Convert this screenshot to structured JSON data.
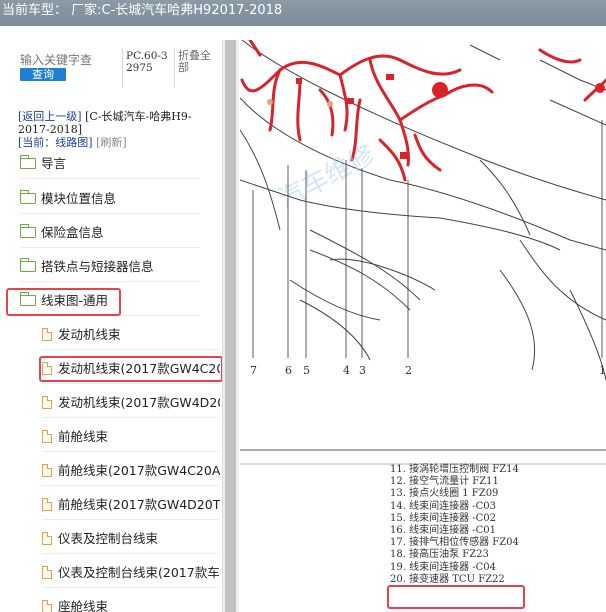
{
  "title": "当前车型：  厂家:C-长城汽车哈弗H92017-2018",
  "search": {
    "placeholder": "输入关键字查",
    "button": "查询"
  },
  "code": "PC.60-32975",
  "collapse_all": "折叠全部",
  "breadcrumb": {
    "back": "[返回上一级]",
    "current_model": "[C-长城汽车-哈弗H9-2017-2018]",
    "current_prefix": "[当前：",
    "current_page": "线路图",
    "current_suffix": "]",
    "refresh": "[刷新]"
  },
  "tree": [
    {
      "label": "导言",
      "icon": "folder-icon"
    },
    {
      "label": "模块位置信息",
      "icon": "folder-icon"
    },
    {
      "label": "保险盒信息",
      "icon": "folder-icon"
    },
    {
      "label": "搭铁点与短接器信息",
      "icon": "folder-icon"
    },
    {
      "label": "线束图-通用",
      "icon": "folder-open-icon"
    },
    {
      "label": "发动机线束",
      "icon": "document-icon"
    },
    {
      "label": "发动机线束(2017款GW4C20",
      "icon": "document-icon"
    },
    {
      "label": "发动机线束(2017款GW4D20",
      "icon": "document-icon"
    },
    {
      "label": "前舱线束",
      "icon": "document-icon"
    },
    {
      "label": "前舱线束(2017款GW4C20A+",
      "icon": "document-icon"
    },
    {
      "label": "前舱线束(2017款GW4D20T+",
      "icon": "document-icon"
    },
    {
      "label": "仪表及控制台线束",
      "icon": "document-icon"
    },
    {
      "label": "仪表及控制台线束(2017款车",
      "icon": "document-icon"
    },
    {
      "label": "座舱线束",
      "icon": "document-icon"
    }
  ],
  "diagram": {
    "callouts": [
      "7",
      "6",
      "5",
      "4",
      "3",
      "2",
      "1"
    ],
    "legend": [
      "11. 接涡轮增压控制阀 FZ14",
      "12. 接空气流量计 FZ11",
      "13. 接点火线圈 1 FZ09",
      "14. 线束间连接器 -C03",
      "15. 线束间连接器 -C02",
      "16. 线束间连接器 -C01",
      "17. 接排气相位传感器 FZ04",
      "18. 接高压油泵 FZ23",
      "19. 线束间连接器 -C04",
      "20. 接变速器 TCU FZ22"
    ],
    "watermark": "汽车维修"
  },
  "colors": {
    "highlight": "#e5444d",
    "harness": "#d9232b",
    "link": "#1a3f9c",
    "button": "#1f7fd1"
  }
}
